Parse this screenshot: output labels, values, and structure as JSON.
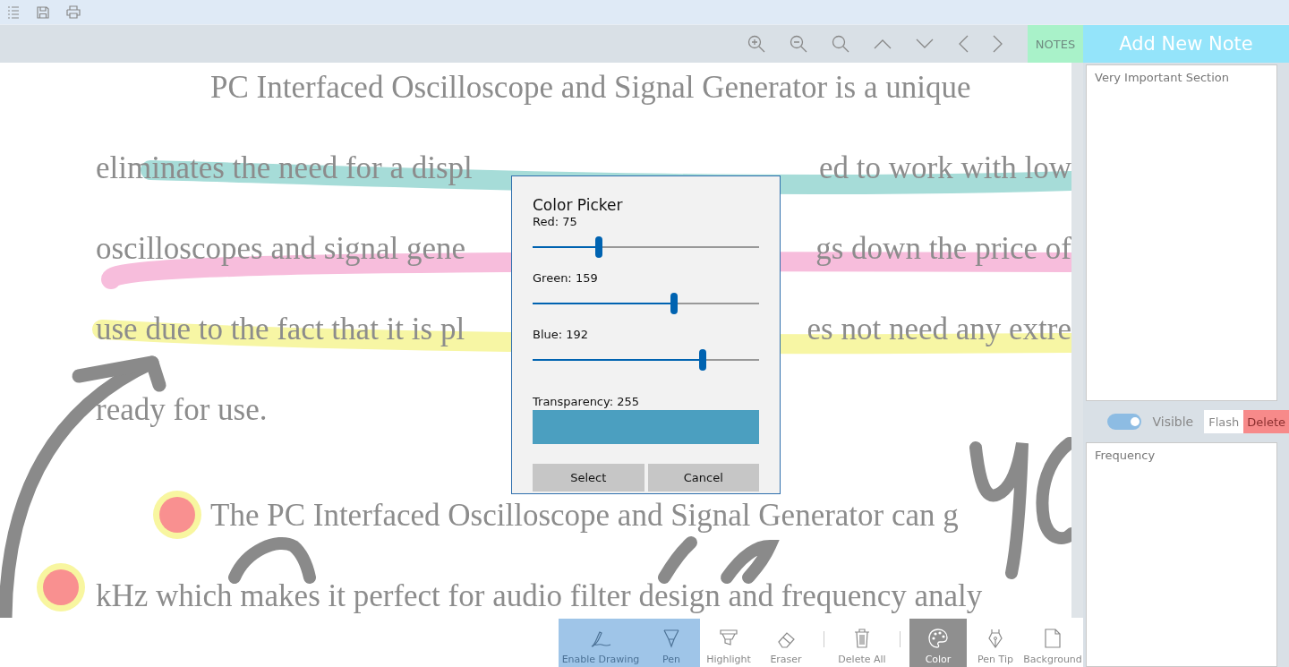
{
  "notes_button": "NOTES",
  "add_note_button": "Add New Note",
  "document": {
    "lines": [
      {
        "kind": "first",
        "segments": [
          "PC Interfaced Oscilloscope and Signal Generator is a unique"
        ]
      },
      {
        "kind": "body",
        "segments": [
          "eliminates the need for a displ",
          "ed to work with low"
        ]
      },
      {
        "kind": "body",
        "segments": [
          "oscilloscopes and signal gene",
          "gs down the price of"
        ]
      },
      {
        "kind": "body",
        "segments": [
          "use due to the fact that it is pl",
          "es not need any extre"
        ]
      },
      {
        "kind": "body",
        "segments": [
          "ready for use."
        ]
      },
      {
        "kind": "first",
        "segments": [
          "The PC Interfaced Oscilloscope and Signal Generator can g"
        ]
      },
      {
        "kind": "body",
        "segments": [
          "kHz which makes it perfect for audio filter design and frequency analy"
        ]
      }
    ]
  },
  "color_picker": {
    "title": "Color Picker",
    "sliders": [
      {
        "label": "Red: 75",
        "level": 0.2941
      },
      {
        "label": "Green: 159",
        "level": 0.6235
      },
      {
        "label": "Blue: 192",
        "level": 0.7529
      }
    ],
    "transparency_label": "Transparency: 255",
    "buttons": [
      "Select",
      "Cancel"
    ]
  },
  "notes": {
    "first_note": {
      "placeholder": "Very Important Section"
    },
    "visible_toggle": {
      "label": "Visible",
      "on": true
    },
    "flash_button": "Flash",
    "delete_button": "Delete",
    "second_note": {
      "placeholder": "Frequency"
    }
  },
  "tool_groups": [
    [
      {
        "kind": "enable",
        "label": "Enable Drawing",
        "selected": true
      },
      {
        "kind": "pen",
        "label": "Pen",
        "selected": true
      },
      {
        "kind": "highlight",
        "label": "Highlight",
        "selected": false
      },
      {
        "kind": "eraser",
        "label": "Eraser",
        "selected": false
      }
    ],
    [
      {
        "kind": "delete",
        "label": "Delete All",
        "selected": false
      }
    ],
    [
      {
        "kind": "color",
        "label": "Color",
        "selected": true
      },
      {
        "kind": "pentip",
        "label": "Pen Tip",
        "selected": false
      },
      {
        "kind": "background",
        "label": "Background",
        "selected": false
      }
    ]
  ]
}
